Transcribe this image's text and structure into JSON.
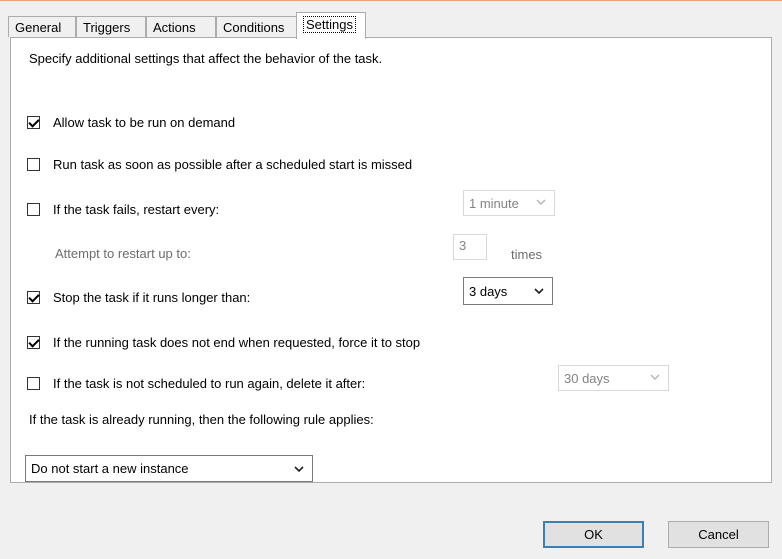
{
  "tabs": [
    {
      "label": "General"
    },
    {
      "label": "Triggers"
    },
    {
      "label": "Actions"
    },
    {
      "label": "Conditions"
    },
    {
      "label": "Settings"
    }
  ],
  "active_tab": "Settings",
  "description": "Specify additional settings that affect the behavior of the task.",
  "options": {
    "allow_on_demand": {
      "label": "Allow task to be run on demand",
      "checked": true
    },
    "run_missed": {
      "label": "Run task as soon as possible after a scheduled start is missed",
      "checked": false
    },
    "restart_on_fail": {
      "label": "If the task fails, restart every:",
      "checked": false,
      "interval": "1 minute"
    },
    "restart_attempts": {
      "label": "Attempt to restart up to:",
      "value": "3",
      "unit": "times"
    },
    "stop_if_longer": {
      "label": "Stop the task if it runs longer than:",
      "checked": true,
      "duration": "3 days"
    },
    "force_stop": {
      "label": "If the running task does not end when requested, force it to stop",
      "checked": true
    },
    "delete_after": {
      "label": "If the task is not scheduled to run again, delete it after:",
      "checked": false,
      "duration": "30 days"
    }
  },
  "running_rule": {
    "label": "If the task is already running, then the following rule applies:",
    "value": "Do not start a new instance"
  },
  "buttons": {
    "ok": "OK",
    "cancel": "Cancel"
  },
  "icons": {
    "check": "check-icon",
    "dropdown": "chevron-down-icon"
  }
}
